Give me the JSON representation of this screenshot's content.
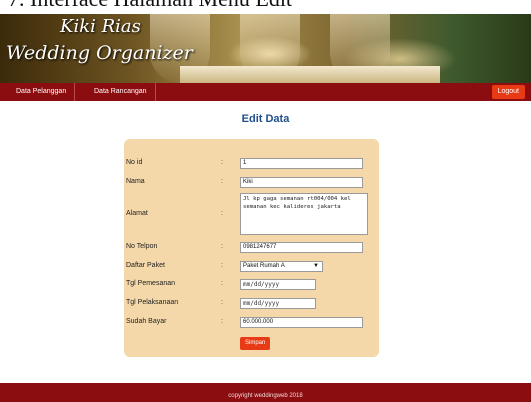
{
  "caption": "7.   Interface Halaman Menu Edit",
  "header": {
    "logo_line1": "Kiki Rias",
    "logo_line2": "Wedding Organizer"
  },
  "nav": {
    "items": [
      {
        "label": "Data Pelanggan"
      },
      {
        "label": "Data Rancangan"
      }
    ],
    "logout_label": "Logout"
  },
  "page_title": "Edit Data",
  "form": {
    "fields": [
      {
        "label": "No id",
        "value": "1"
      },
      {
        "label": "Nama",
        "value": "Kiki"
      },
      {
        "label": "Alamat",
        "value": "Jl kp gaga semanan rt004/004 kel semanan kec kalideres jakarta"
      },
      {
        "label": "No Telpon",
        "value": "0981247677"
      },
      {
        "label": "Daftar Paket",
        "value": "Paket Rumah A"
      },
      {
        "label": "Tgl Pemesanan",
        "placeholder": "mm/dd/yyyy"
      },
      {
        "label": "Tgl Pelaksanaan",
        "placeholder": "mm/dd/yyyy"
      },
      {
        "label": "Sudah Bayar",
        "value": "60.000.000"
      }
    ],
    "colon": ":",
    "submit_label": "Simpan"
  },
  "footer": {
    "text": "copyright weddingweb 2018"
  },
  "colors": {
    "nav_bg": "#8c0d10",
    "accent": "#e83a14",
    "panel_bg": "#f5d8aa",
    "title": "#1f4e8c"
  }
}
